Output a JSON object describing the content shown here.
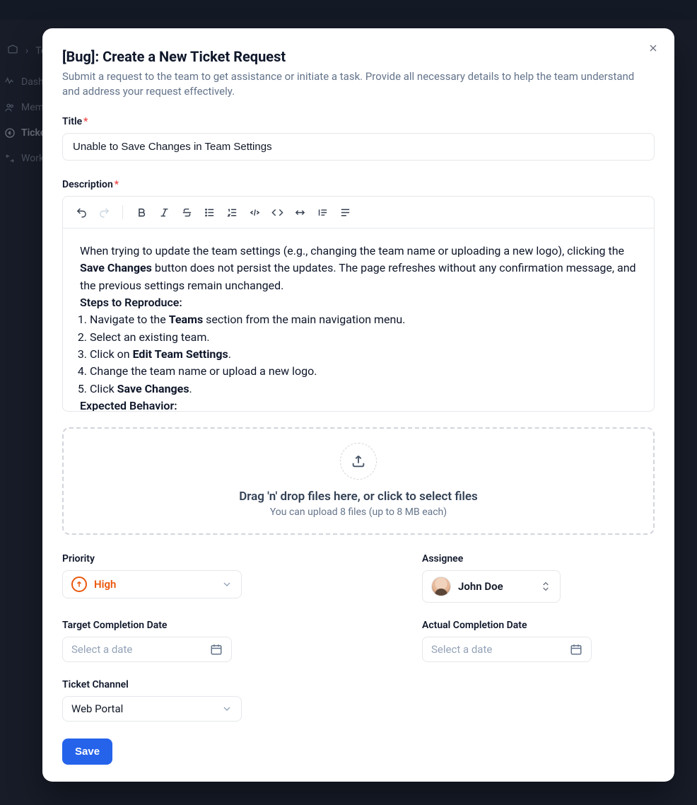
{
  "background": {
    "breadcrumb_home": "Te",
    "nav": {
      "dashboard": "Dashb",
      "members": "Memb",
      "tickets": "Ticket",
      "workflows": "Workf"
    }
  },
  "modal": {
    "title": "[Bug]: Create a New Ticket Request",
    "subtitle": "Submit a request to the team to get assistance or initiate a task. Provide all necessary details to help the team understand and address your request effectively."
  },
  "fields": {
    "title_label": "Title",
    "title_value": "Unable to Save Changes in Team Settings",
    "description_label": "Description",
    "description": {
      "intro_before_bold": "When trying to update the team settings (e.g., changing the team name or uploading a new logo), clicking the ",
      "intro_bold": "Save Changes",
      "intro_after_bold": " button does not persist the updates. The page refreshes without any confirmation message, and the previous settings remain unchanged.",
      "steps_heading": "Steps to Reproduce:",
      "steps": {
        "s1_pre": "Navigate to the ",
        "s1_bold": "Teams",
        "s1_post": " section from the main navigation menu.",
        "s2": "Select an existing team.",
        "s3_pre": "Click on ",
        "s3_bold": "Edit Team Settings",
        "s3_post": ".",
        "s4": "Change the team name or upload a new logo.",
        "s5_pre": "Click ",
        "s5_bold": "Save Changes",
        "s5_post": "."
      },
      "expected_heading": "Expected Behavior:"
    },
    "dropzone": {
      "main": "Drag 'n' drop files here, or click to select files",
      "sub": "You can upload 8 files (up to 8 MB each)"
    },
    "priority_label": "Priority",
    "priority_value": "High",
    "assignee_label": "Assignee",
    "assignee_value": "John Doe",
    "target_date_label": "Target Completion Date",
    "target_date_placeholder": "Select a date",
    "actual_date_label": "Actual Completion Date",
    "actual_date_placeholder": "Select a date",
    "channel_label": "Ticket Channel",
    "channel_value": "Web Portal"
  },
  "actions": {
    "save": "Save"
  }
}
